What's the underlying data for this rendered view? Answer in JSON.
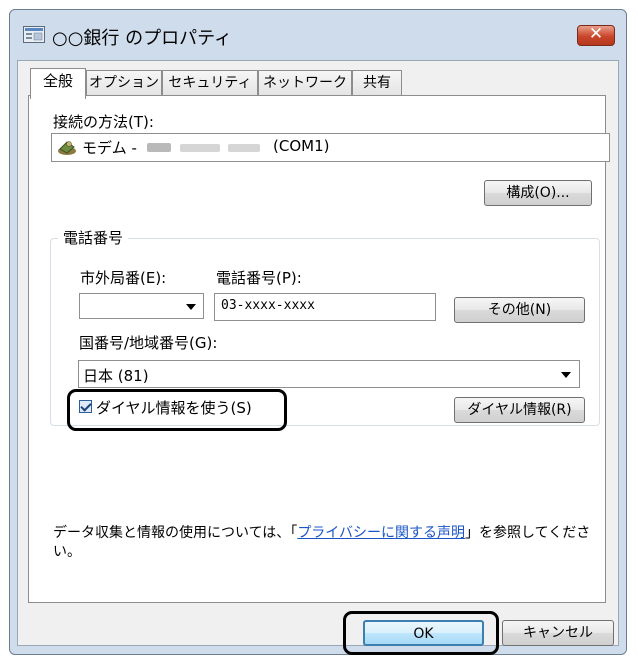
{
  "window": {
    "title": "○○銀行 のプロパティ",
    "close_label": "✕"
  },
  "tabs": [
    {
      "label": "全般",
      "active": true
    },
    {
      "label": "オプション",
      "active": false
    },
    {
      "label": "セキュリティ",
      "active": false
    },
    {
      "label": "ネットワーク",
      "active": false
    },
    {
      "label": "共有",
      "active": false
    }
  ],
  "connect": {
    "label": "接続の方法(T):",
    "modem_prefix": "モデム -",
    "modem_port": "(COM1)",
    "configure_button": "構成(O)..."
  },
  "phone": {
    "group_label": "電話番号",
    "area_code_label": "市外局番(E):",
    "area_code_value": "",
    "phone_number_label": "電話番号(P):",
    "phone_number_value": "03-xxxx-xxxx",
    "other_button": "その他(N)",
    "country_label": "国番号/地域番号(G):",
    "country_value": "日本 (81)",
    "use_dialing_rules_label": "ダイヤル情報を使う(S)",
    "use_dialing_rules_checked": true,
    "dialing_rules_button": "ダイヤル情報(R)"
  },
  "privacy": {
    "text_before": "データ収集と情報の使用については、「",
    "link_text": "プライバシーに関する声明",
    "text_after": "」を参照してください。"
  },
  "footer": {
    "ok_button": "OK",
    "cancel_button": "キャンセル"
  }
}
